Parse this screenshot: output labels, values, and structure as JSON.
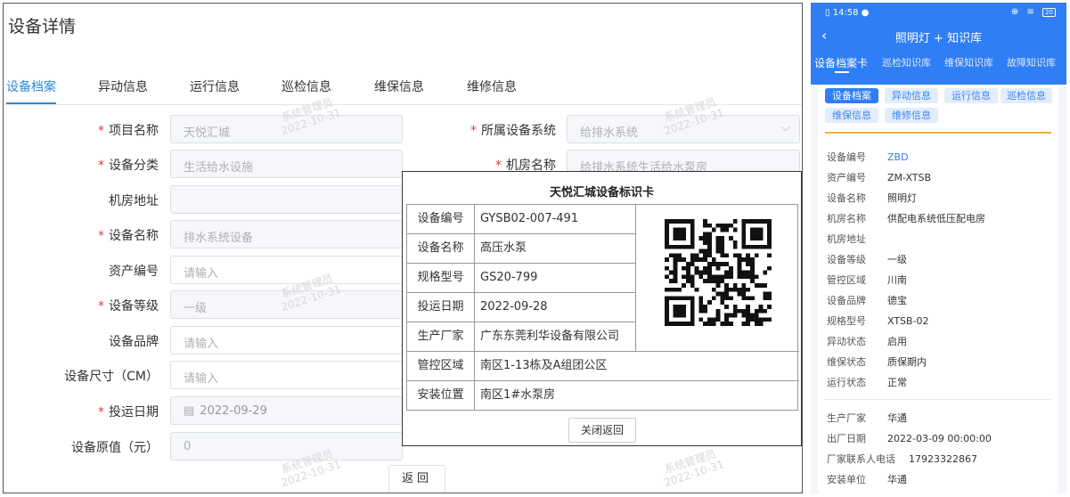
{
  "desktop": {
    "title": "设备详情",
    "tabs": [
      "设备档案",
      "异动信息",
      "运行信息",
      "巡检信息",
      "维保信息",
      "维修信息"
    ],
    "watermark": {
      "name": "系统管理员",
      "date": "2022-10-31"
    },
    "fields": {
      "project_name": {
        "label": "项目名称",
        "value": "天悦汇城"
      },
      "system": {
        "label": "所属设备系统",
        "value": "给排水系统"
      },
      "category": {
        "label": "设备分类",
        "value": "生活给水设施"
      },
      "room_name": {
        "label": "机房名称",
        "value": "给排水系统生活给水泵房"
      },
      "room_address": {
        "label": "机房地址",
        "value": ""
      },
      "device_name": {
        "label": "设备名称",
        "value": "排水系统设备"
      },
      "asset_no": {
        "label": "资产编号",
        "placeholder": "请输入"
      },
      "level": {
        "label": "设备等级",
        "value": "一级"
      },
      "brand": {
        "label": "设备品牌",
        "placeholder": "请输入"
      },
      "size": {
        "label": "设备尺寸（CM）",
        "placeholder": "请输入"
      },
      "date": {
        "label": "投运日期",
        "value": "2022-09-29"
      },
      "original_value": {
        "label": "设备原值（元）",
        "value": "0"
      }
    },
    "back_label": "返回"
  },
  "card": {
    "title": "天悦汇城设备标识卡",
    "rows": [
      {
        "key": "设备编号",
        "value": "GYSB02-007-491"
      },
      {
        "key": "设备名称",
        "value": "高压水泵"
      },
      {
        "key": "规格型号",
        "value": "GS20-799"
      },
      {
        "key": "投运日期",
        "value": "2022-09-28"
      },
      {
        "key": "生产厂家",
        "value": "广东东莞利华设备有限公司"
      },
      {
        "key": "管控区域",
        "value": "南区1-13栋及A组团公区"
      },
      {
        "key": "安装位置",
        "value": "南区1#水泵房"
      }
    ],
    "close_label": "关闭返回"
  },
  "mobile": {
    "time": "14:58",
    "battery": "20",
    "title": "照明灯 + 知识库",
    "tabs": [
      "设备档案卡",
      "巡检知识库",
      "维保知识库",
      "故障知识库"
    ],
    "pills": [
      "设备档案",
      "异动信息",
      "运行信息",
      "巡检信息",
      "维保信息",
      "维修信息"
    ],
    "rows": [
      {
        "key": "设备编号",
        "value": "ZBD"
      },
      {
        "key": "资产编号",
        "value": "ZM-XTSB"
      },
      {
        "key": "设备名称",
        "value": "照明灯"
      },
      {
        "key": "机房名称",
        "value": "供配电系统低压配电房"
      },
      {
        "key": "机房地址",
        "value": ""
      },
      {
        "key": "设备等级",
        "value": "一级"
      },
      {
        "key": "管控区域",
        "value": "川南"
      },
      {
        "key": "设备品牌",
        "value": "德宝"
      },
      {
        "key": "规格型号",
        "value": "XTSB-02"
      },
      {
        "key": "异动状态",
        "value": "启用"
      },
      {
        "key": "维保状态",
        "value": "质保期内"
      },
      {
        "key": "运行状态",
        "value": "正常"
      }
    ],
    "rows2": [
      {
        "key": "生产厂家",
        "value": "华通"
      },
      {
        "key": "出厂日期",
        "value": "2022-03-09 00:00:00"
      },
      {
        "key": "厂家联系人电话",
        "value": "17923322867"
      },
      {
        "key": "安装单位",
        "value": "华通"
      }
    ]
  }
}
